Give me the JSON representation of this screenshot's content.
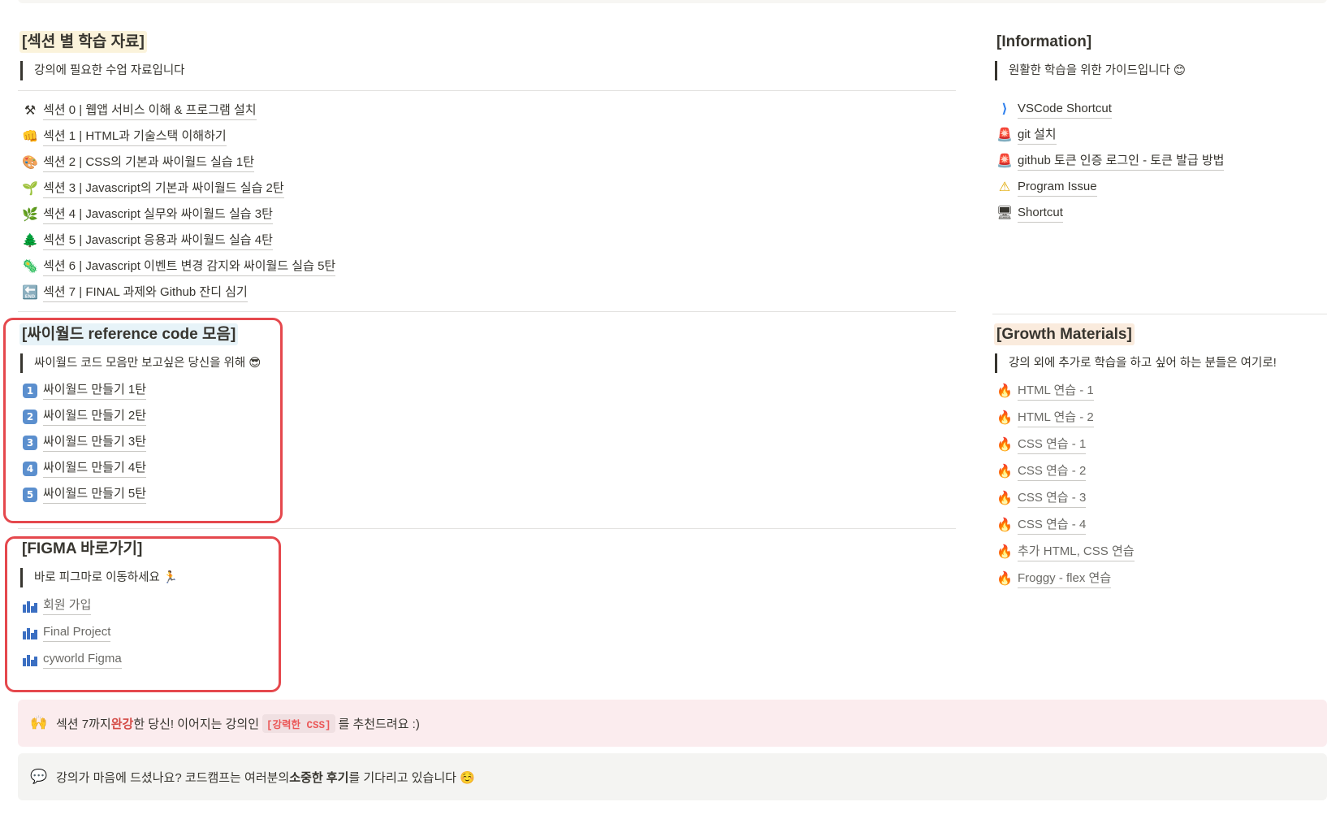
{
  "left": {
    "section1": {
      "title": "[섹션 별 학습 자료]",
      "quote": "강의에 필요한 수업 자료입니다",
      "items": [
        {
          "icon": "⚒",
          "icon_name": "hammer-pick-icon",
          "label": "섹션 0  |  웹앱 서비스 이해 & 프로그램 설치"
        },
        {
          "icon": "👊",
          "icon_name": "fist-icon",
          "label": "섹션 1  |  HTML과 기술스택 이해하기"
        },
        {
          "icon": "🎨",
          "icon_name": "palette-icon",
          "label": "섹션 2  |  CSS의 기본과 싸이월드 실습 1탄"
        },
        {
          "icon": "🌱",
          "icon_name": "seedling-icon",
          "label": "섹션 3  |  Javascript의 기본과 싸이월드 실습 2탄"
        },
        {
          "icon": "🌿",
          "icon_name": "herb-icon",
          "label": "섹션 4  |  Javascript 실무와 싸이월드 실습 3탄"
        },
        {
          "icon": "🌲",
          "icon_name": "tree-icon",
          "label": "섹션 5  |  Javascript 응용과 싸이월드 실습 4탄"
        },
        {
          "icon": "🦠",
          "icon_name": "microbe-icon",
          "label": "섹션 6  |  Javascript 이벤트 변경 감지와 싸이월드 실습 5탄"
        },
        {
          "icon": "🔚",
          "icon_name": "end-arrow-icon",
          "label": "섹션 7  |  FINAL 과제와 Github 잔디 심기"
        }
      ]
    },
    "section2": {
      "title": "[싸이월드 reference code 모음]",
      "quote": "싸이월드 코드 모음만 보고싶은 당신을 위해 😎",
      "items": [
        {
          "num": "1",
          "label": "싸이월드 만들기 1탄"
        },
        {
          "num": "2",
          "label": "싸이월드 만들기 2탄"
        },
        {
          "num": "3",
          "label": "싸이월드 만들기 3탄"
        },
        {
          "num": "4",
          "label": "싸이월드 만들기 4탄"
        },
        {
          "num": "5",
          "label": "싸이월드 만들기 5탄"
        }
      ]
    },
    "section3": {
      "title": "[FIGMA 바로가기]",
      "quote": "바로 피그마로 이동하세요 🏃",
      "items": [
        {
          "label": "회원 가입"
        },
        {
          "label": "Final Project"
        },
        {
          "label": "cyworld Figma"
        }
      ]
    }
  },
  "right": {
    "section1": {
      "title": "[Information]",
      "quote": "원활한 학습을 위한 가이드입니다 😊",
      "items": [
        {
          "icon": "⟩",
          "icon_name": "vscode-icon",
          "label": "VSCode Shortcut"
        },
        {
          "icon": "🚨",
          "icon_name": "siren-icon",
          "label": "git 설치"
        },
        {
          "icon": "🚨",
          "icon_name": "siren-icon",
          "label": "github 토큰 인증 로그인 - 토큰 발급 방법"
        },
        {
          "icon": "⚠",
          "icon_name": "warning-icon",
          "label": "Program Issue"
        },
        {
          "icon": "🖥",
          "icon_name": "desktop-icon",
          "label": "Shortcut"
        }
      ]
    },
    "section2": {
      "title": "[Growth Materials]",
      "quote": "강의 외에 추가로 학습을 하고 싶어 하는 분들은 여기로!",
      "items": [
        {
          "label": "HTML 연습 - 1"
        },
        {
          "label": "HTML 연습 - 2"
        },
        {
          "label": "CSS 연습 - 1"
        },
        {
          "label": "CSS 연습 - 2"
        },
        {
          "label": "CSS 연습 - 3"
        },
        {
          "label": "CSS 연습 - 4"
        },
        {
          "label": "추가 HTML, CSS 연습"
        },
        {
          "label": "Froggy - flex 연습"
        }
      ],
      "icon": "🔥"
    }
  },
  "callouts": {
    "first": {
      "icon": "🙌",
      "before": "섹션 7까지 ",
      "highlight": "완강",
      "middle": "한 당신! 이어지는 강의인 ",
      "code": "[강력한 CSS]",
      "after": " 를 추천드려요 :)"
    },
    "second": {
      "icon": "💬",
      "before": "강의가 마음에 드셨나요? 코드캠프는 여러분의 ",
      "bold": "소중한 후기",
      "after": "를 기다리고 있습니다 ☺️"
    }
  },
  "colors": {
    "highlight_red": "#d44c47",
    "box_red": "#e5484d",
    "callout_pink": "#fbecee",
    "callout_gray": "#f4f4f2"
  }
}
